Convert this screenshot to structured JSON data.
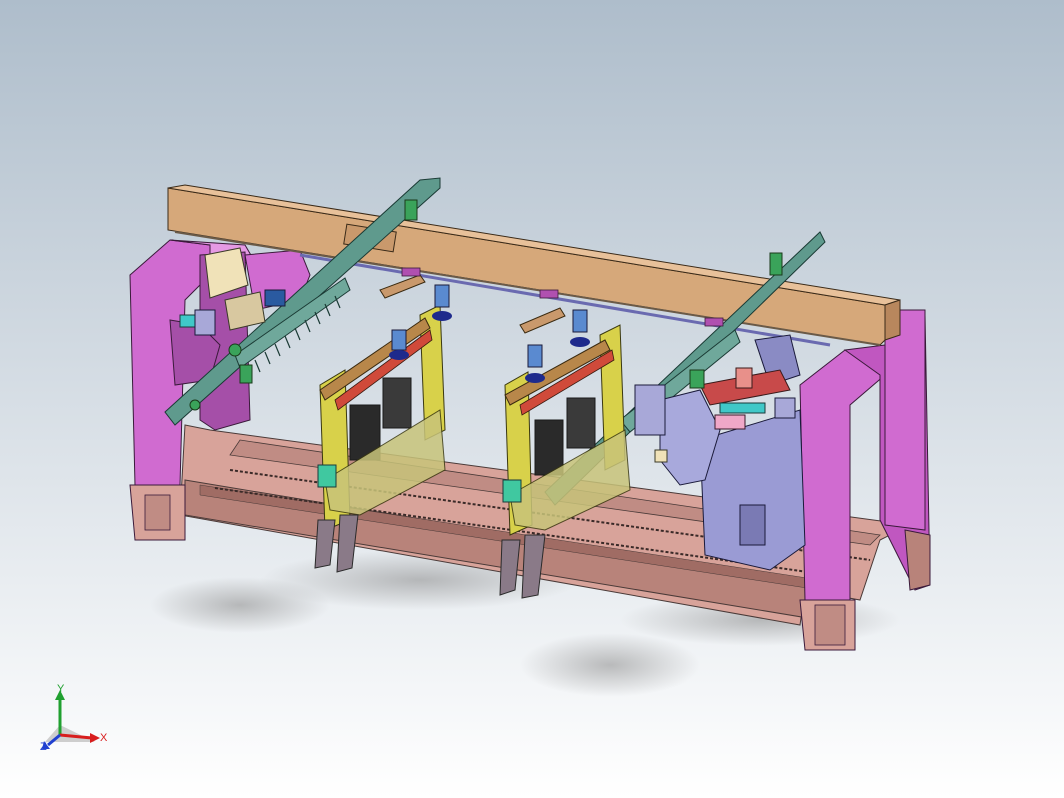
{
  "viewport": {
    "background_top": "#aebdcb",
    "background_bottom": "#ffffff"
  },
  "colors": {
    "frame": "#d06bd0",
    "frame_dark": "#a54fa8",
    "beam": "#d6a87a",
    "beam_dark": "#b8875d",
    "base": "#d8a39a",
    "base_dark": "#b8837a",
    "rail": "#5f9a8d",
    "carriage": "#d8d14a",
    "gray_block": "#9a9bd4",
    "blue_cup": "#1e2a8c",
    "green_part": "#3aa35a"
  },
  "triad": {
    "x_label": "X",
    "y_label": "Y",
    "z_label": "Z",
    "x_color": "#d81e1e",
    "y_color": "#20a030",
    "z_color": "#2040d0"
  }
}
